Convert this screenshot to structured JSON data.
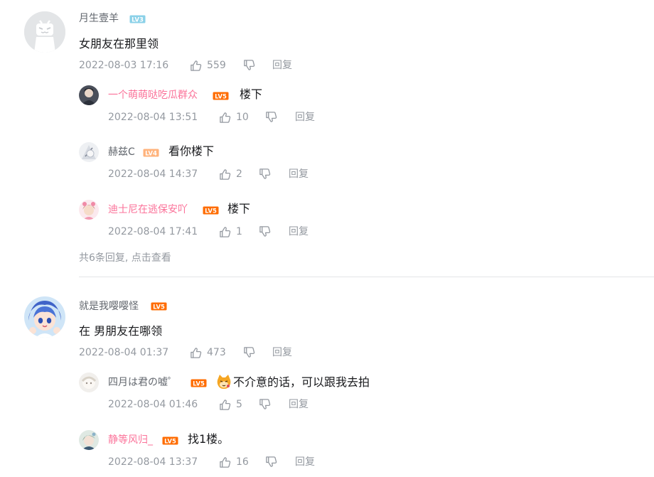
{
  "level_labels": {
    "lv3": "LV3",
    "lv4": "LV4",
    "lv5": "LV5"
  },
  "colors": {
    "pink_name": "#fb7299",
    "gray_name": "#61666d",
    "meta": "#9499a0",
    "lv3": "#8bd1e8",
    "lv4": "#ffb37c",
    "lv5": "#ff6c00"
  },
  "c1": {
    "user": "月生壹羊",
    "level": "LV3",
    "text": "女朋友在那里领",
    "time": "2022-08-03 17:16",
    "likes": "559",
    "reply": "回复",
    "replies": [
      {
        "user": "一个萌萌哒吃瓜群众",
        "level": "LV5",
        "text": "楼下",
        "time": "2022-08-04 13:51",
        "likes": "10",
        "reply": "回复"
      },
      {
        "user": "赫兹C",
        "level": "LV4",
        "text": "看你楼下",
        "time": "2022-08-04 14:37",
        "likes": "2",
        "reply": "回复"
      },
      {
        "user": "迪士尼在逃保安吖",
        "level": "LV5",
        "text": "楼下",
        "time": "2022-08-04 17:41",
        "likes": "1",
        "reply": "回复"
      }
    ],
    "more": "共6条回复, 点击查看"
  },
  "c2": {
    "user": "就是我嘤嘤怪",
    "level": "LV5",
    "text": "在 男朋友在哪领",
    "time": "2022-08-04 01:37",
    "likes": "473",
    "reply": "回复",
    "replies": [
      {
        "user": "四月は君の嘘゜",
        "level": "LV5",
        "text": "不介意的话，可以跟我去拍",
        "emote": "cat-emote",
        "time": "2022-08-04 01:46",
        "likes": "5",
        "reply": "回复"
      },
      {
        "user": "静等风归_",
        "level": "LV5",
        "text": "找1楼。",
        "time": "2022-08-04 13:37",
        "likes": "16",
        "reply": "回复"
      }
    ]
  }
}
